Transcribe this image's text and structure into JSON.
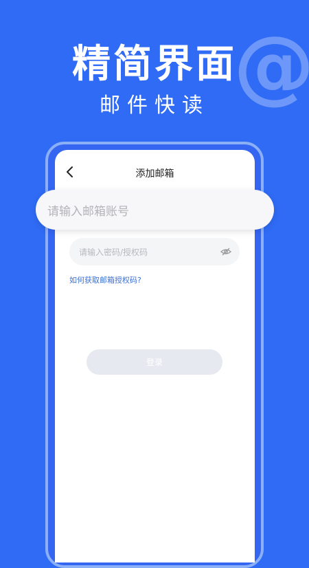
{
  "hero": {
    "title": "精简界面",
    "subtitle": "邮件快读",
    "decoration": "@"
  },
  "screen": {
    "title": "添加邮箱",
    "email_placeholder": "请输入邮箱账号",
    "password_placeholder": "请输入密码/授权码",
    "help_link": "如何获取邮箱授权码?",
    "login_label": "登录"
  },
  "colors": {
    "background": "#2f6bf5",
    "link": "#3d6fd0",
    "button_disabled": "#e6e9ef"
  }
}
